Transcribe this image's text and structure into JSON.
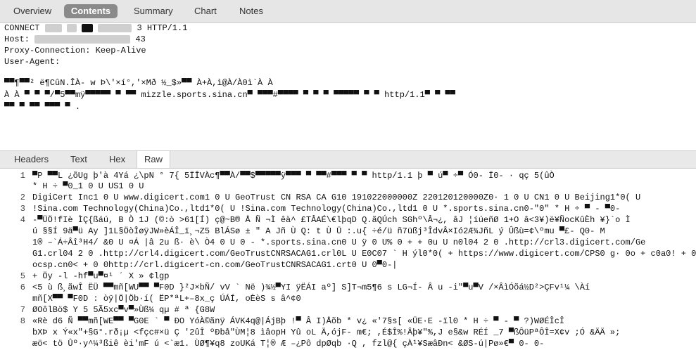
{
  "top_tabs": {
    "items": [
      {
        "label": "Overview",
        "active": false
      },
      {
        "label": "Contents",
        "active": true
      },
      {
        "label": "Summary",
        "active": false
      },
      {
        "label": "Chart",
        "active": false
      },
      {
        "label": "Notes",
        "active": false
      }
    ]
  },
  "request": {
    "connect": "CONNECT",
    "connect_tail": "3 HTTP/1.1",
    "host": "Host:",
    "host_tail": "43",
    "proxy": "Proxy-Connection: Keep-Alive",
    "ua": "User-Agent:",
    "body1": "▀▀¶▀▀² ë¶CûN.ÎÀ- w Þ\\'×í°,'×Mð ½_$»▀▀ À+À,ì@À/À0ì`À À",
    "body2": "À À ▀ ▀ ▀/▀5▀▀mÿ▀▀▀▀▀ ▀ ▀▀ mizzle.sports.sina.cn▀ ▀▀▀#▀▀▀▀ ▀      ▀ ▀ ▀▀▀▀▀ ▀ ▀      http/1.1▀ ▀ ▀▀",
    "body3": "▀▀ ▀ ▀▀ ▀▀▀ ▀ ."
  },
  "bottom_tabs": {
    "items": [
      {
        "label": "Headers",
        "active": false
      },
      {
        "label": "Text",
        "active": false
      },
      {
        "label": "Hex",
        "active": false
      },
      {
        "label": "Raw",
        "active": true
      }
    ]
  },
  "raw": {
    "rows": [
      {
        "num": "1",
        "text": "  ▀P ▀▀L ¿õUg þ'à 4Yá ¿\\pN ° 7{ 5ÏÎVÀc¶▀▀À/▀▀$▀▀▀▀▀ÿ▀▀▀ ▀ ▀▀#▀▀▀ ▀ ▀      http/1.1  þ ▀ ú▀ ÷▀ Ó0- Ï0- ·    qç  5(ûÒ"
      },
      {
        "num": "",
        "text": "       * H  ÷ ▀0_1 0      U  US1 0  U"
      },
      {
        "num": "2",
        "text": " DigiCert Inc1 0  U   www.digicert.com1 0  U   GeoTrust CN RSA CA G10  191022000000Z 220120120000Z0·  1 0      U   CN1 0  U   Beijing1*0(  U"
      },
      {
        "num": "3",
        "text": " !Sina.com Technology(China)Co.,ltd1*0(  U  !Sina.com Technology(China)Co.,ltd1 0  U   *.sports.sina.cn0-\"0\"   *  H  ÷ ▀ - ▀0-"
      },
      {
        "num": "4",
        "text": " -▀ÜÖ!fIè ÌÇ{ßáú, B Ò 1J        (©:ò >61[Í)  ç@~B® Å  Ñ     ¬Ì êà^ £TÂAÉ\\€lþqD Q.ãQÚch  SGhº\\Â¬¿,  âJ ¦íúeñØ  1+O  â<3¥)ë¥ÑocKûÈh ¥}`o Ì"
      },
      {
        "num": "",
        "text": " ú  §§Í  9ä▀ü Ay  ]1L§ÖòÎøÿJW»èÁÎ_ï¸¬Z5 BlÁSø ±  \"  A    Jñ Ù  Q: t     Ù Ü   :.u{  ÷é/ü         ñ7üßj³ÎdvÂ×Ió2Æ¾JñL ý   Ûßù=¢\\ºmu     ▀£- Q0- M"
      },
      {
        "num": "",
        "text": " 1®  –`Á÷Âî³H4/ &0  U    ¤Á    |â 2u  ß· è\\  Ò4  0  U  0 - *.sports.sina.cn0  U ÿ      0  U% 0  +      +     0u  U  n0l04 2 0  .http://crl3.digicert.com/Ge"
      },
      {
        "num": "",
        "text": " G1.crl04 2 0  .http://crl4.digicert.com/GeoTrustCNRSACAG1.crl0L  U  E0C07  ` H  ýl0*0( +    https://www.digicert.com/CPS0 g·  0o +    c0a0! +  0"
      },
      {
        "num": "",
        "text": " ocsp.cn0< +    0   0http://crl.digicert-cn.com/GeoTrustCNRSACAG1.crt0         U  0▀0-|"
      },
      {
        "num": "5",
        "text": " +  Öy  -l -hf▀u▀¤¹  ´ X   » ¢lgp"
      },
      {
        "num": "6",
        "text": " <5  ù ß¸ãwÎ ËÜ ▀▀mñ[WU▀▀ ▀F0D }²J×bÑ/ vV   `   Në )¾½▀YI   ÿËÁI aº]  S]T¬m5¶6   s  LG¬Í- Â   u -i\"▀u▀V    /×ÂìÓõá½D²>ÇFv¹¼  \\Àí"
      },
      {
        "num": "",
        "text": " mñ[X▀▀ ▀F0D :        òÿ|Ö|Öb·í(  ËP*ªL+–8x_ç ÚÁÍ,  oÈèS  s â^¢0"
      },
      {
        "num": "7",
        "text": " ØOôlBö$ Y  5 5Ã5xc▀v▀»Ùß¼   qµ      #  ª   {G8W"
      },
      {
        "num": "8",
        "text": " «Rè     d6   Ñ   ▀▀mñ[WE▀▀  ▀G0E   `  ▀  ÐO  YóÀ©ãnÿ   ÁVK4q@|ÁjBþ !▀   Â    I)Åõb  *  v¿   «'7§s[ «ÜE·E  -ïl0 *  H  ÷  ▀ - ▀ ?)WØÉÎcÎ"
      },
      {
        "num": "",
        "text": " bXÞ x    Ý«x\"+§G°.rð¡µ <fçc#×ü   Ç '2ûÎ   ºÐbå\"ÙM¦8  ìâopH  Yû      oL   Ä,ójF-    m€;    ,É$Î%!Âþ¥\"%,J e§&w   RÉÍ   _7 ▀ßÔüPªÔÎ=X¢v ;Ó   &ÄÄ »;"
      },
      {
        "num": "",
        "text": " æö< tö Ûº·y^¼³ßiê   èi'mF ú   <`æ1.        ÙØ¶¥q8 zoUKá  T¦®   Æ   –¿Pô dpØqb  ·Q   , fzl@{  çÀ¹¥SæâÐn<   &ØS-ú|Pø»€▀  0-  0-"
      }
    ]
  }
}
